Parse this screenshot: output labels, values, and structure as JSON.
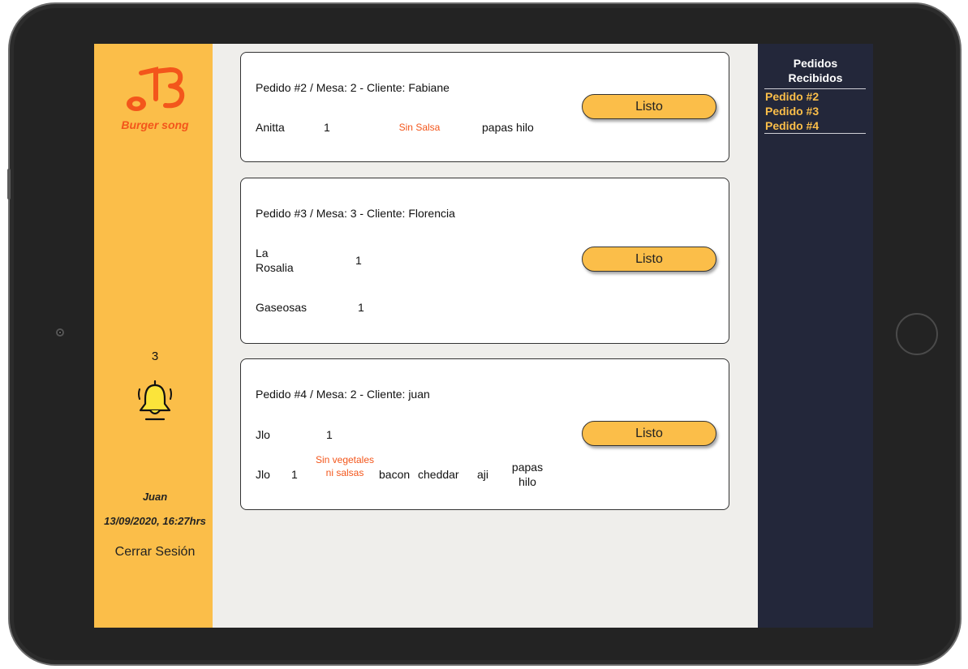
{
  "brand": {
    "logo_text": "Burger song",
    "primary_color": "#fbbe49",
    "accent_color": "#f3561b",
    "dark_color": "#23273a"
  },
  "sidebar": {
    "notification_count": "3",
    "user_name": "Juan",
    "datetime": "13/09/2020, 16:27hrs",
    "logout_label": "Cerrar Sesión"
  },
  "orders": [
    {
      "title": "Pedido #2 / Mesa: 2 - Cliente: Fabiane",
      "button_label": "Listo",
      "items": [
        {
          "name": "Anitta",
          "qty": "1",
          "note": "Sin Salsa",
          "extra": "papas hilo"
        }
      ]
    },
    {
      "title": "Pedido #3 / Mesa: 3 - Cliente: Florencia",
      "button_label": "Listo",
      "items": [
        {
          "name": "La Rosalia",
          "qty": "1"
        },
        {
          "name": "Gaseosas",
          "qty": "1"
        }
      ]
    },
    {
      "title": "Pedido #4 / Mesa: 2 - Cliente: juan",
      "button_label": "Listo",
      "items": [
        {
          "name": "Jlo",
          "qty": "1"
        },
        {
          "name": "Jlo",
          "qty": "1",
          "note": "Sin vegetales ni salsas",
          "extras": [
            "bacon",
            "cheddar",
            "aji",
            "papas hilo"
          ]
        }
      ]
    }
  ],
  "received": {
    "title": "Pedidos Recibidos",
    "items": [
      "Pedido #2",
      "Pedido #3",
      "Pedido #4"
    ]
  }
}
